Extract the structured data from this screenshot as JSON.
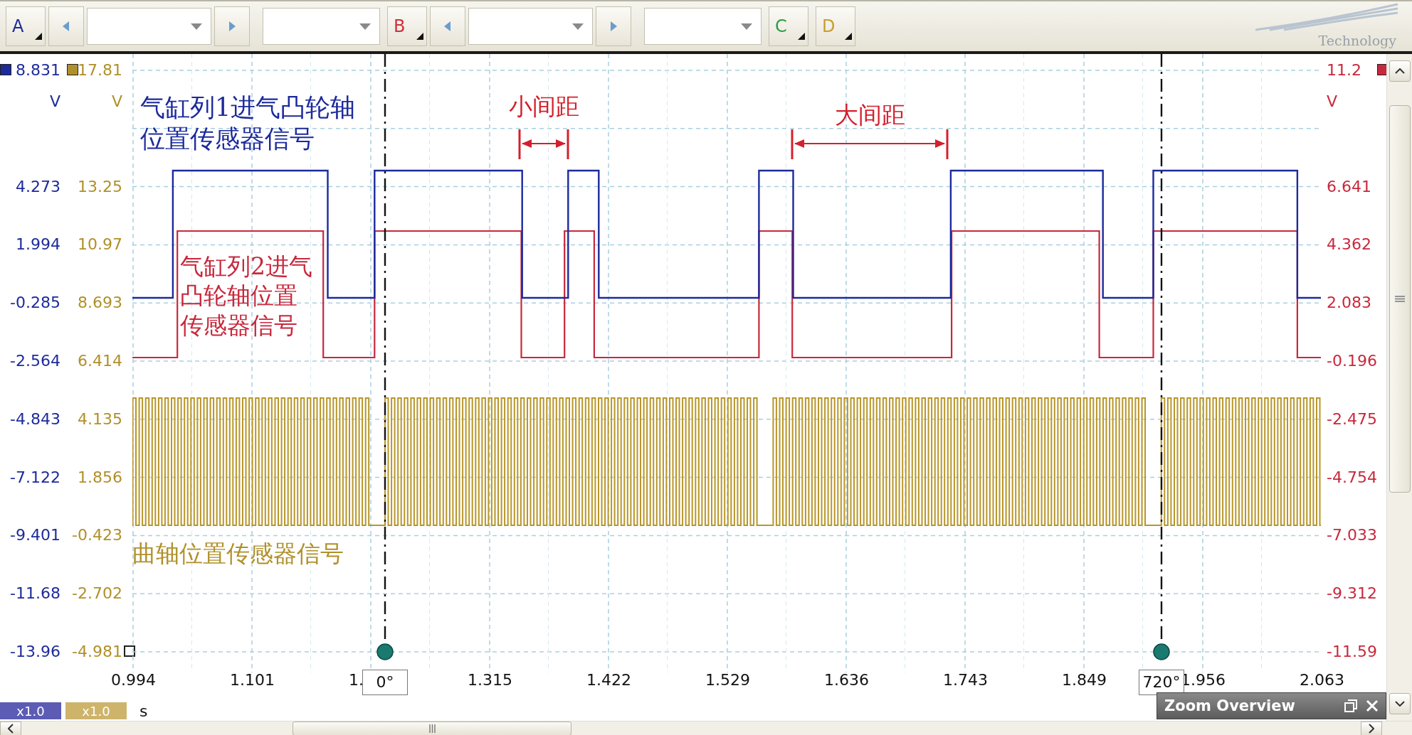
{
  "toolbar": {
    "groups": [
      {
        "kind": "navigable",
        "channel": {
          "label": "A",
          "color": "#1c2a9c"
        }
      },
      {
        "kind": "navigable",
        "channel": {
          "label": "B",
          "color": "#d0303c"
        }
      },
      {
        "kind": "plain",
        "channel": {
          "label": "C",
          "color": "#2a9a40"
        }
      },
      {
        "kind": "plain",
        "channel": {
          "label": "D",
          "color": "#c8a030"
        }
      }
    ]
  },
  "logo": {
    "text": "Technology"
  },
  "left_axes": [
    {
      "unit": "V",
      "color": "#1c2a9c",
      "ticks": [
        "8.831",
        "4.273",
        "1.994",
        "-0.285",
        "-2.564",
        "-4.843",
        "-7.122",
        "-9.401",
        "-11.68",
        "-13.96"
      ]
    },
    {
      "unit": "V",
      "color": "#b0902a",
      "ticks": [
        "17.81",
        "13.25",
        "10.97",
        "8.693",
        "6.414",
        "4.135",
        "1.856",
        "-0.423",
        "-2.702",
        "-4.981"
      ]
    }
  ],
  "right_axis": {
    "unit": "V",
    "color": "#c8283c",
    "ticks": [
      "11.2",
      "6.641",
      "4.362",
      "2.083",
      "-0.196",
      "-2.475",
      "-4.754",
      "-7.033",
      "-9.312",
      "-11.59"
    ]
  },
  "x_axis": {
    "unit": "s",
    "ticks": [
      "0.994",
      "1.101",
      "1.",
      "1.315",
      "1.422",
      "1.529",
      "1.636",
      "1.743",
      "1.849",
      "1.956",
      "2.063"
    ]
  },
  "signal_labels": [
    {
      "text": "气缸列1进气凸轮轴位置传感器信号",
      "color": "#1c2a9c"
    },
    {
      "text": "气缸列2进气凸轮轴位置传感器信号",
      "color": "#c8283c"
    },
    {
      "text": "曲轴位置传感器信号",
      "color": "#b0902a"
    }
  ],
  "gap_markers": [
    {
      "text": "小间距"
    },
    {
      "text": "大间距"
    }
  ],
  "cursors": [
    {
      "label": "0°"
    },
    {
      "label": "720°"
    }
  ],
  "scale_tags": [
    {
      "text": "x1.0",
      "color": "#5c5cb4"
    },
    {
      "text": "x1.0",
      "color": "#cdb46a"
    }
  ],
  "zoom_overview": {
    "title": "Zoom Overview"
  }
}
